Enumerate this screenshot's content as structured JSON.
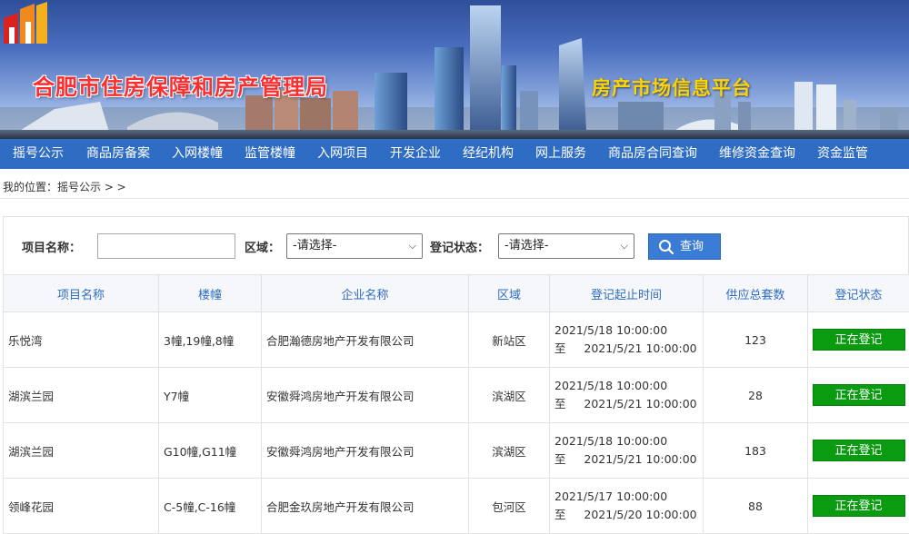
{
  "header": {
    "site_title": "合肥市住房保障和房产管理局",
    "platform_title": "房产市场信息平台"
  },
  "nav": {
    "items": [
      "摇号公示",
      "商品房备案",
      "入网楼幢",
      "监管楼幢",
      "入网项目",
      "开发企业",
      "经纪机构",
      "网上服务",
      "商品房合同查询",
      "维修资金查询",
      "资金监管"
    ]
  },
  "breadcrumb": "我的位置：摇号公示 > >",
  "search": {
    "project_label": "项目名称：",
    "project_value": "",
    "district_label": "区域：",
    "district_selected": "-请选择-",
    "status_label": "登记状态：",
    "status_selected": "-请选择-",
    "search_button": "查询"
  },
  "table": {
    "headers": [
      "项目名称",
      "楼幢",
      "企业名称",
      "区域",
      "登记起止时间",
      "供应总套数",
      "登记状态"
    ],
    "rows": [
      {
        "name": "乐悦湾",
        "building": "3幢,19幢,8幢",
        "company": "合肥瀚德房地产开发有限公司",
        "district": "新站区",
        "start": "2021/5/18 10:00:00",
        "to": "至",
        "end": "2021/5/21 10:00:00",
        "total": "123",
        "status": "正在登记"
      },
      {
        "name": "湖滨兰园",
        "building": "Y7幢",
        "company": "安徽舜鸿房地产开发有限公司",
        "district": "滨湖区",
        "start": "2021/5/18 10:00:00",
        "to": "至",
        "end": "2021/5/21 10:00:00",
        "total": "28",
        "status": "正在登记"
      },
      {
        "name": "湖滨兰园",
        "building": "G10幢,G11幢",
        "company": "安徽舜鸿房地产开发有限公司",
        "district": "滨湖区",
        "start": "2021/5/18 10:00:00",
        "to": "至",
        "end": "2021/5/21 10:00:00",
        "total": "183",
        "status": "正在登记"
      },
      {
        "name": "领峰花园",
        "building": "C-5幢,C-16幢",
        "company": "合肥金玖房地产开发有限公司",
        "district": "包河区",
        "start": "2021/5/17 10:00:00",
        "to": "至",
        "end": "2021/5/20 10:00:00",
        "total": "88",
        "status": "正在登记"
      }
    ]
  },
  "colors": {
    "nav_bg": "#2f6cc3",
    "status_green": "#0a9b11",
    "title_red": "#ff2d2d",
    "platform_yellow": "#ffd400"
  }
}
